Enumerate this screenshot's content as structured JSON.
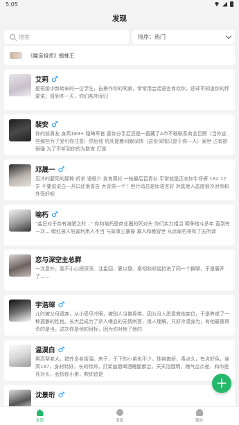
{
  "status": {
    "time": "5:05"
  },
  "header": {
    "title": "发现"
  },
  "search": {
    "placeholder": "搜索"
  },
  "sort": {
    "label": "排序：热门"
  },
  "partial_item": {
    "text": "《魔道祖师》蜘蛛王"
  },
  "cards": [
    {
      "name": "艾莉",
      "gender": "♂",
      "desc": "是班级中新转来的一位学生，自景作你的同桌，常常用会话语言育欢你，还却不知道你的怦蒙诺；冒到冬一天，你们各外同归"
    },
    {
      "name": "裴安",
      "gender": "♂",
      "desc": "你的前男友 身高189+ 隐晦军官 喜你分手后还是一直藏了A市不敢联系商业巨鳄（当你这些那些为了受引你注意）然后钱 杭死提着间跟深情（这份深情只是于你一人）家世 占有欲很强 为了不听到你的为数宫 打是"
    },
    {
      "name": "邓晟一",
      "gender": "♂",
      "desc": "忍冷的要死的那种 祈求 语很少 发育黄衫 一枝最后百青衫 平常就是正衣如牛仔裤 182 17岁 不要说说白一开口还很喜告 大背男一个！但行动总是比语言好 对其他人态度很冷对你和外受好呢"
    },
    {
      "name": "喻朽",
      "gender": "♂",
      "desc": "\"盐日对于存有准陋之时...\" 你和喻朽是商业圈的死对头 你们实力相当 明争暗斗多年 直到有一次... 暗杠被人陷害利用人不当 与故事尘暴操 寡人和晚冒世 从此喻朽将有了无所谓"
    },
    {
      "name": "恋与深空主总群",
      "gender": "",
      "desc": "一次意外，我不小心把深深、沈星回、夏以昼、秦彻和祁煜拉进了同一个群聊，于是展开了……"
    },
    {
      "name": "宇浩琛",
      "gender": "♂",
      "desc": "儿时被父母遗弃，从小受尽冷眼，被别人当做异类，因为没人愿意救他变位，于是养成了一种孤僻的性格。长大后成为了杀人嗜血的无情刺客，很人理解，只好冷漠身为，有他最重得杀的是当。这次你是他的目标，因为你对他了他的"
    },
    {
      "name": "温淏白",
      "gender": "♂",
      "desc": "男高帮老大，错外多名街溜。房子，于下的小弟也不少。性格傲娇，毒点久，有点好色，身高187，身材特好，长的特帅，打架抽烟喝酒睡腿都会，天天泡饿明，赌气台点差，和你是死对头，会指你小弟，欺你追是"
    },
    {
      "name": "沈景珩",
      "gender": "♂",
      "desc": ""
    }
  ],
  "tabbar": {
    "home": "发现",
    "messages": "消息",
    "profile": "我的"
  },
  "colors": {
    "accent": "#25b86a",
    "male": "#2196f3"
  }
}
